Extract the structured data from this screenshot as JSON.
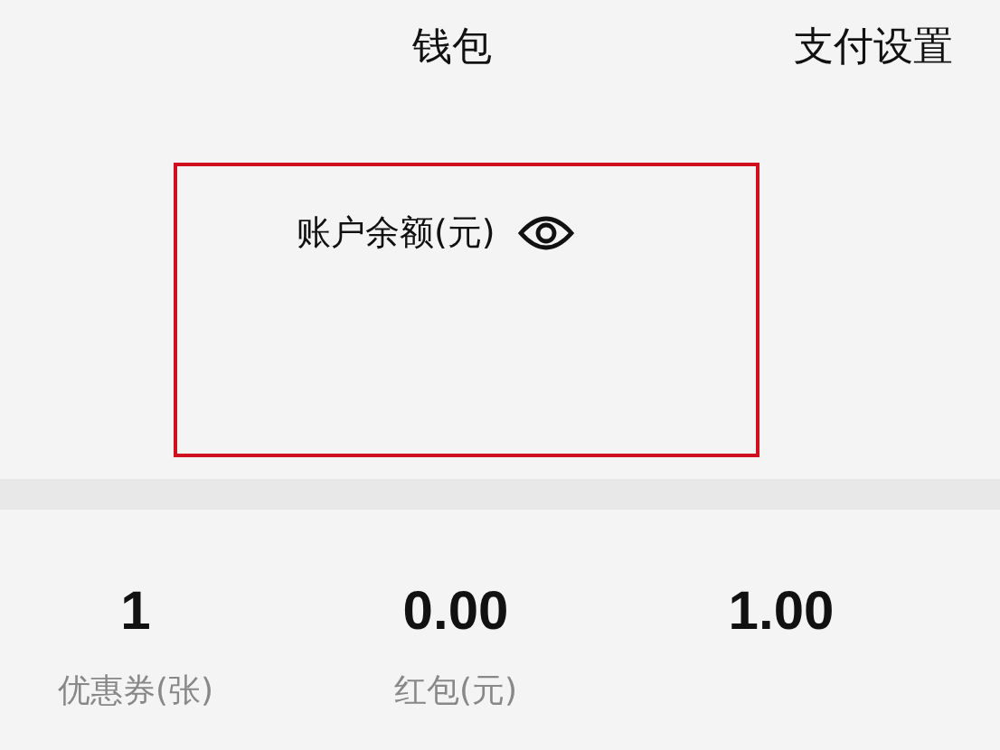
{
  "header": {
    "title": "钱包",
    "action": "支付设置"
  },
  "balance": {
    "label": "账户余额(元)"
  },
  "stats": [
    {
      "value": "1",
      "label": "优惠券(张)"
    },
    {
      "value": "0.00",
      "label": "红包(元)"
    },
    {
      "value": "1.00"
    }
  ]
}
